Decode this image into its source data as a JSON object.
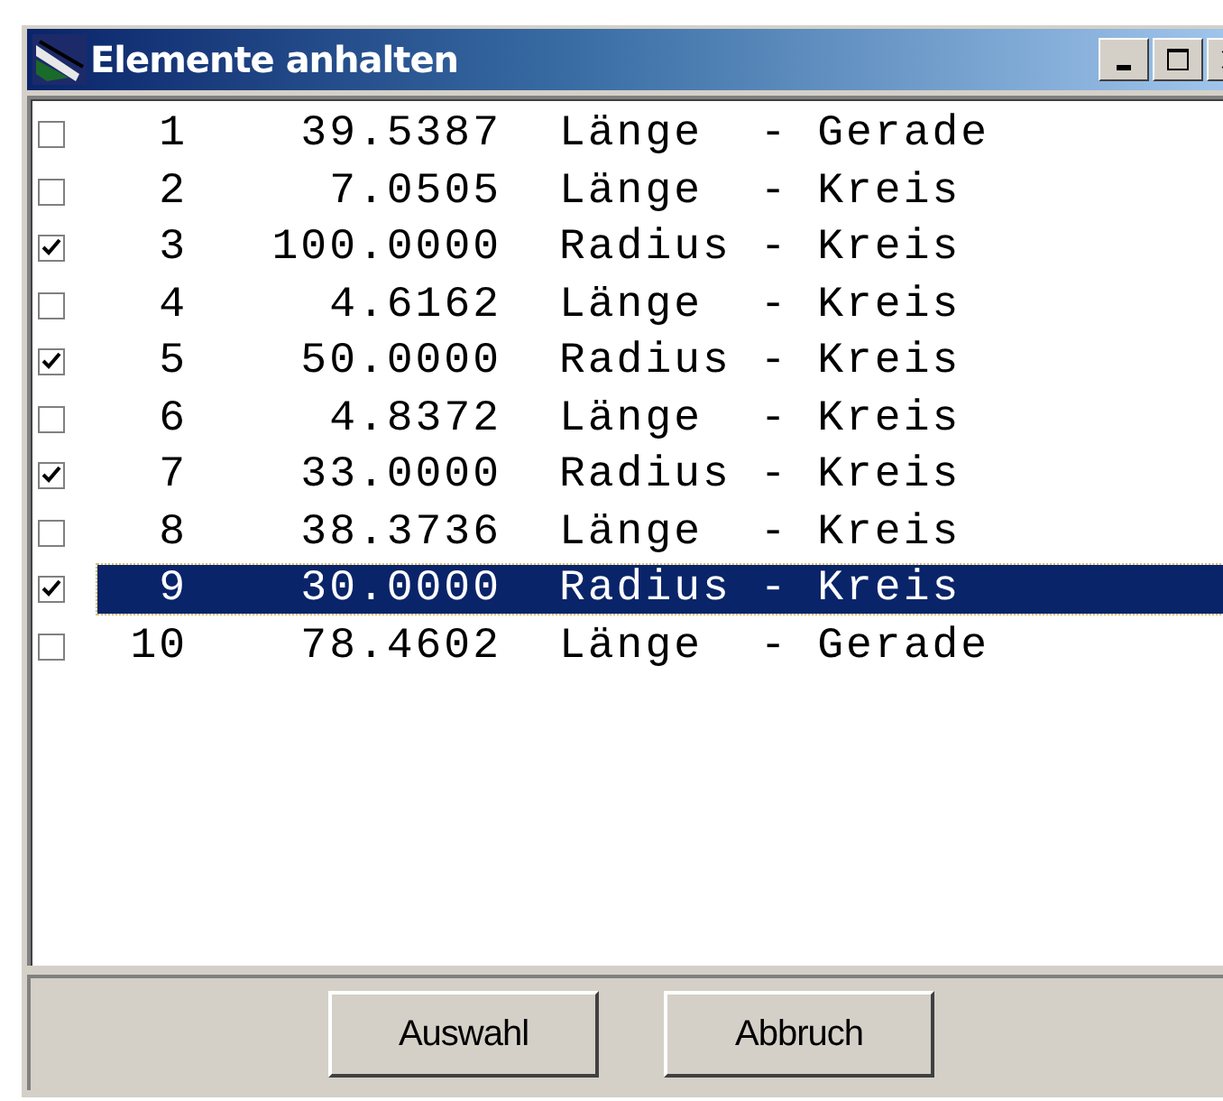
{
  "window": {
    "title": "Elemente anhalten"
  },
  "rows": [
    {
      "checked": false,
      "selected": false,
      "number": "1",
      "value": "39.5387",
      "description": "Länge  - Gerade"
    },
    {
      "checked": false,
      "selected": false,
      "number": "2",
      "value": "7.0505",
      "description": "Länge  - Kreis"
    },
    {
      "checked": true,
      "selected": false,
      "number": "3",
      "value": "100.0000",
      "description": "Radius - Kreis"
    },
    {
      "checked": false,
      "selected": false,
      "number": "4",
      "value": "4.6162",
      "description": "Länge  - Kreis"
    },
    {
      "checked": true,
      "selected": false,
      "number": "5",
      "value": "50.0000",
      "description": "Radius - Kreis"
    },
    {
      "checked": false,
      "selected": false,
      "number": "6",
      "value": "4.8372",
      "description": "Länge  - Kreis"
    },
    {
      "checked": true,
      "selected": false,
      "number": "7",
      "value": "33.0000",
      "description": "Radius - Kreis"
    },
    {
      "checked": false,
      "selected": false,
      "number": "8",
      "value": "38.3736",
      "description": "Länge  - Kreis"
    },
    {
      "checked": true,
      "selected": true,
      "number": "9",
      "value": "30.0000",
      "description": "Radius - Kreis"
    },
    {
      "checked": false,
      "selected": false,
      "number": "10",
      "value": "78.4602",
      "description": "Länge  - Gerade"
    }
  ],
  "buttons": [
    "Auswahl",
    "Abbruch"
  ]
}
